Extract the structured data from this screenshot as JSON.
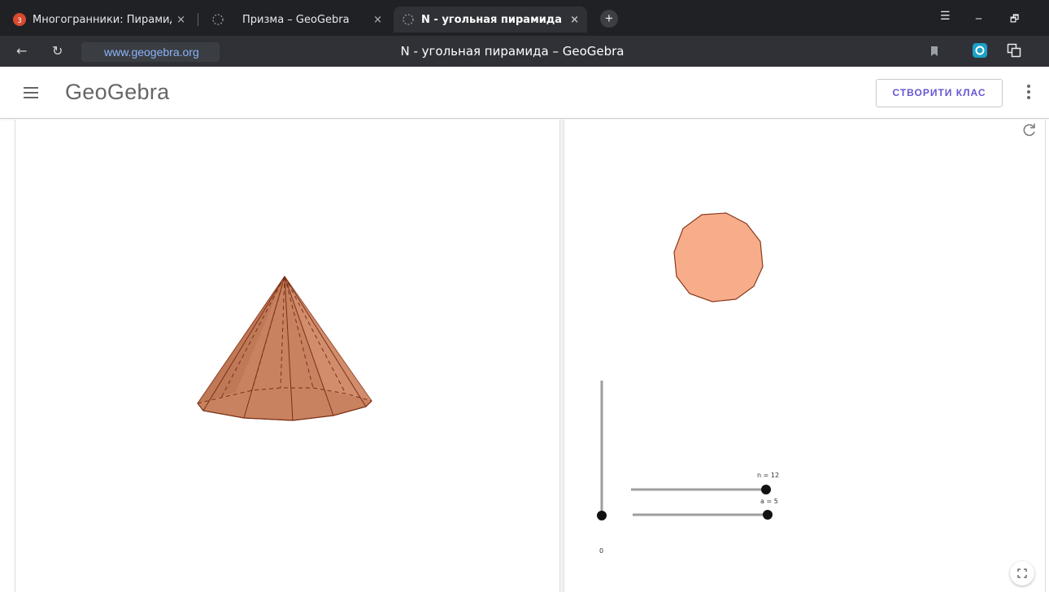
{
  "browser": {
    "tabs": [
      {
        "title": "Многогранники: Пирамид",
        "close": "×"
      },
      {
        "title": "Призма – GeoGebra",
        "close": "×"
      },
      {
        "title": "N - угольная пирамида – Ge",
        "close": "×"
      }
    ],
    "new_tab": "+",
    "window_controls": {
      "menu": "☰",
      "minimize": "_",
      "restore": "🗗"
    },
    "url": "www.geogebra.org",
    "page_title": "N - угольная пирамида – GeoGebra"
  },
  "app": {
    "logo": "GeoGebra",
    "create_class_button": "СТВОРИТИ КЛАС"
  },
  "sliders": {
    "n_label": "n = 12",
    "a_label": "a = 5",
    "vertical_label": "0",
    "n_value": 12,
    "a_value": 5,
    "vertical_value": 0
  },
  "colors": {
    "polygon_fill": "#f8ad8a",
    "pyramid_fill": "#c9825f",
    "edge": "#8b3a1e",
    "slider_track": "#9e9e9e"
  }
}
